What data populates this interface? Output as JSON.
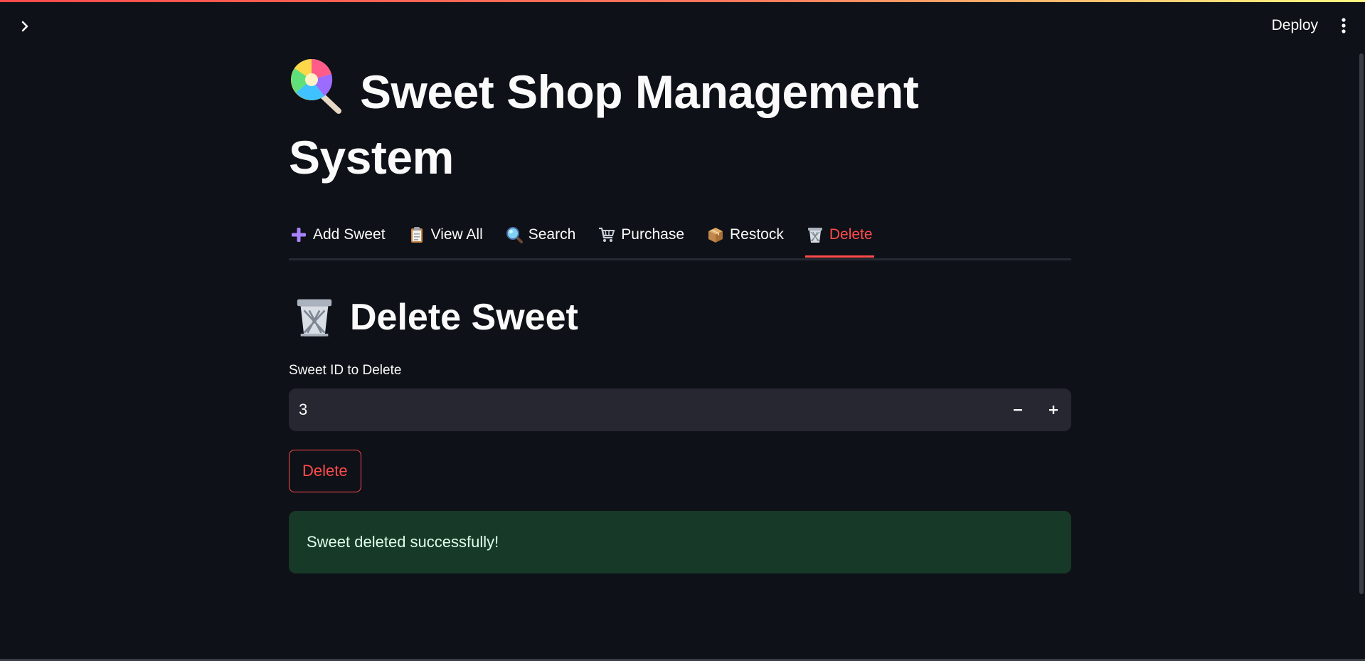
{
  "header": {
    "deploy_label": "Deploy",
    "sidebar_icon": "chevron-right-icon",
    "menu_icon": "kebab-menu-icon"
  },
  "main": {
    "title": "Sweet Shop Management System",
    "title_icon": "lollipop-icon",
    "tabs": [
      {
        "label": "Add Sweet",
        "icon": "plus-icon"
      },
      {
        "label": "View All",
        "icon": "clipboard-icon"
      },
      {
        "label": "Search",
        "icon": "magnifier-icon"
      },
      {
        "label": "Purchase",
        "icon": "shopping-cart-icon"
      },
      {
        "label": "Restock",
        "icon": "package-icon"
      },
      {
        "label": "Delete",
        "icon": "wastebasket-icon"
      }
    ],
    "active_tab": "Delete",
    "section_title": "Delete Sweet",
    "section_icon": "wastebasket-icon",
    "field_label": "Sweet ID to Delete",
    "field_value": "3",
    "delete_button": "Delete",
    "success_message": "Sweet deleted successfully!"
  },
  "colors": {
    "background": "#0e1117",
    "accent": "#ff4b4b",
    "input_bg": "#262730",
    "success_bg": "#173928",
    "success_text": "#dffde9"
  }
}
